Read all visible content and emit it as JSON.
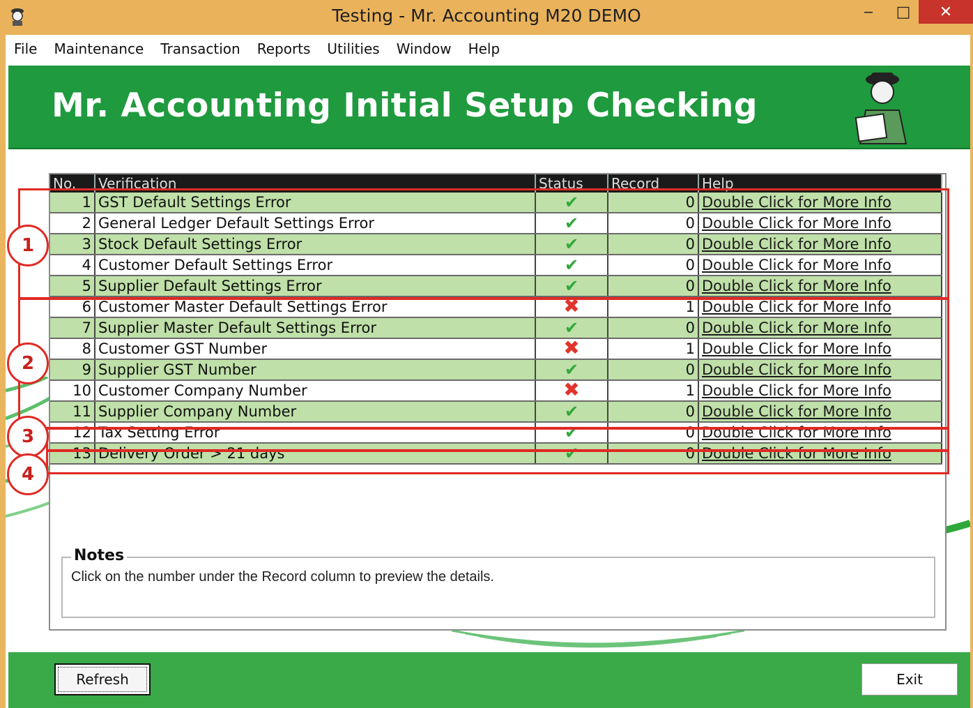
{
  "window": {
    "title": "Testing - Mr. Accounting M20 DEMO",
    "minimize": "‒",
    "maximize": "□",
    "close": "✕"
  },
  "menu": [
    "File",
    "Maintenance",
    "Transaction",
    "Reports",
    "Utilities",
    "Window",
    "Help"
  ],
  "banner": {
    "title": "Mr. Accounting Initial Setup Checking"
  },
  "grid": {
    "headers": [
      "No.",
      "Verification",
      "Status",
      "Record",
      "Help"
    ],
    "rows": [
      {
        "no": "1",
        "verification": "GST Default Settings Error",
        "status": "ok",
        "record": "0",
        "help": "Double Click for More Info"
      },
      {
        "no": "2",
        "verification": "General Ledger Default Settings Error",
        "status": "ok",
        "record": "0",
        "help": "Double Click for More Info"
      },
      {
        "no": "3",
        "verification": "Stock Default Settings Error",
        "status": "ok",
        "record": "0",
        "help": "Double Click for More Info"
      },
      {
        "no": "4",
        "verification": "Customer Default Settings Error",
        "status": "ok",
        "record": "0",
        "help": "Double Click for More Info"
      },
      {
        "no": "5",
        "verification": "Supplier Default Settings Error",
        "status": "ok",
        "record": "0",
        "help": "Double Click for More Info"
      },
      {
        "no": "6",
        "verification": "Customer Master Default Settings Error",
        "status": "error",
        "record": "1",
        "help": "Double Click for More Info"
      },
      {
        "no": "7",
        "verification": "Supplier Master Default Settings Error",
        "status": "ok",
        "record": "0",
        "help": "Double Click for More Info"
      },
      {
        "no": "8",
        "verification": "Customer GST Number",
        "status": "error",
        "record": "1",
        "help": "Double Click for More Info"
      },
      {
        "no": "9",
        "verification": "Supplier GST Number",
        "status": "ok",
        "record": "0",
        "help": "Double Click for More Info"
      },
      {
        "no": "10",
        "verification": "Customer Company Number",
        "status": "error",
        "record": "1",
        "help": "Double Click for More Info"
      },
      {
        "no": "11",
        "verification": "Supplier Company Number",
        "status": "ok",
        "record": "0",
        "help": "Double Click for More Info"
      },
      {
        "no": "12",
        "verification": "Tax Setting Error",
        "status": "ok",
        "record": "0",
        "help": "Double Click for More Info"
      },
      {
        "no": "13",
        "verification": "Delivery Order > 21 days",
        "status": "ok",
        "record": "0",
        "help": "Double Click for More Info"
      }
    ]
  },
  "notes": {
    "legend": "Notes",
    "text": "Click on the number under the Record column to preview the details."
  },
  "buttons": {
    "refresh": "Refresh",
    "exit": "Exit"
  },
  "annotations": [
    "1",
    "2",
    "3",
    "4"
  ],
  "colors": {
    "accent_green": "#1f9a3e",
    "row_green": "#bfe0a8",
    "ok": "#2fa83a",
    "error": "#e0352b",
    "annotation_red": "#e02a24"
  }
}
